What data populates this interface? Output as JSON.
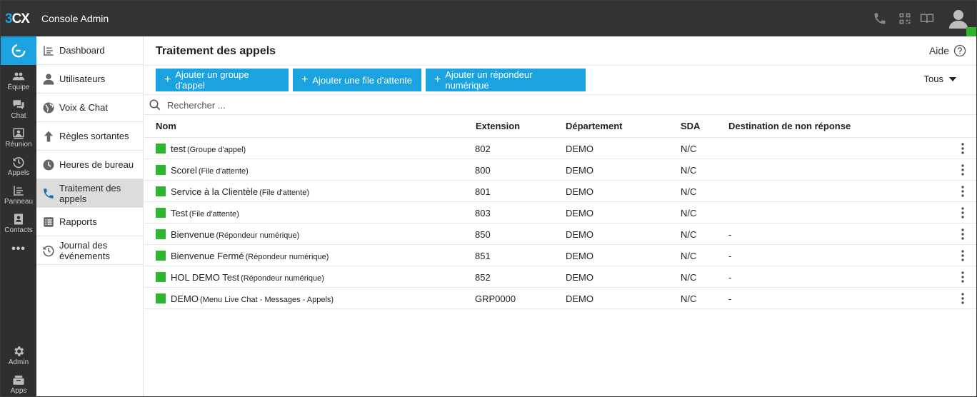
{
  "app": {
    "logo_a": "3",
    "logo_b": "CX",
    "title": "Console Admin",
    "accent_color": "#1aa3e0",
    "status_color": "#2db52d"
  },
  "top_icons": [
    "phone-icon",
    "qr-code-icon",
    "book-icon",
    "user-avatar-icon"
  ],
  "rail": {
    "items": [
      {
        "label": "Équipe",
        "icon": "team-icon"
      },
      {
        "label": "Chat",
        "icon": "chat-icon"
      },
      {
        "label": "Réunion",
        "icon": "meeting-icon"
      },
      {
        "label": "Appels",
        "icon": "history-icon"
      },
      {
        "label": "Panneau",
        "icon": "panel-icon"
      },
      {
        "label": "Contacts",
        "icon": "contacts-icon"
      }
    ],
    "more": "•••",
    "bottom": [
      {
        "label": "Admin",
        "icon": "gear-icon"
      },
      {
        "label": "Apps",
        "icon": "apps-icon"
      }
    ]
  },
  "sidebar": {
    "items": [
      {
        "label": "Dashboard",
        "icon": "dashboard-icon"
      },
      {
        "label": "Utilisateurs",
        "icon": "user-icon"
      },
      {
        "label": "Voix & Chat",
        "icon": "globe-icon"
      },
      {
        "label": "Règles sortantes",
        "icon": "arrow-up-icon"
      },
      {
        "label": "Heures de bureau",
        "icon": "clock-icon"
      },
      {
        "label": "Traitement des appels",
        "icon": "phone-icon"
      },
      {
        "label": "Rapports",
        "icon": "list-icon"
      },
      {
        "label": "Journal des événements",
        "icon": "history-icon"
      }
    ]
  },
  "main": {
    "title": "Traitement des appels",
    "help_label": "Aide",
    "buttons": {
      "add_group": "Ajouter un groupe d'appel",
      "add_queue": "Ajouter une file d'attente",
      "add_ivr": "Ajouter un répondeur numérique"
    },
    "filter": "Tous",
    "search_placeholder": "Rechercher ...",
    "columns": {
      "name": "Nom",
      "extension": "Extension",
      "department": "Département",
      "sda": "SDA",
      "no_answer": "Destination de non réponse"
    },
    "rows": [
      {
        "name": "test",
        "type": "(Groupe d'appel)",
        "extension": "802",
        "department": "DEMO",
        "sda": "N/C",
        "no_answer": ""
      },
      {
        "name": "Scorel",
        "type": "(File d'attente)",
        "extension": "800",
        "department": "DEMO",
        "sda": "N/C",
        "no_answer": ""
      },
      {
        "name": "Service à la Clientèle",
        "type": "(File d'attente)",
        "extension": "801",
        "department": "DEMO",
        "sda": "N/C",
        "no_answer": ""
      },
      {
        "name": "Test",
        "type": "(File d'attente)",
        "extension": "803",
        "department": "DEMO",
        "sda": "N/C",
        "no_answer": ""
      },
      {
        "name": "Bienvenue",
        "type": "(Répondeur numérique)",
        "extension": "850",
        "department": "DEMO",
        "sda": "N/C",
        "no_answer": "-"
      },
      {
        "name": "Bienvenue Fermé",
        "type": "(Répondeur numérique)",
        "extension": "851",
        "department": "DEMO",
        "sda": "N/C",
        "no_answer": "-"
      },
      {
        "name": "HOL DEMO Test",
        "type": "(Répondeur numérique)",
        "extension": "852",
        "department": "DEMO",
        "sda": "N/C",
        "no_answer": "-"
      },
      {
        "name": "DEMO",
        "type": "(Menu Live Chat - Messages - Appels)",
        "extension": "GRP0000",
        "department": "DEMO",
        "sda": "N/C",
        "no_answer": "-"
      }
    ]
  }
}
